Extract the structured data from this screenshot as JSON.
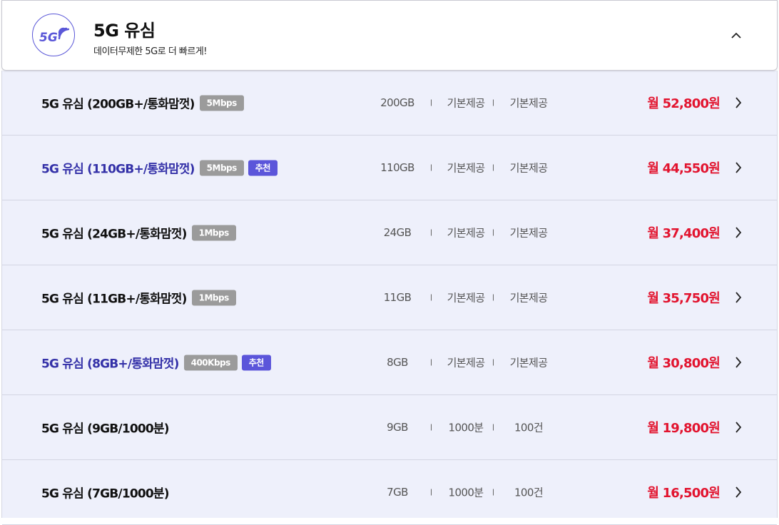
{
  "header": {
    "title": "5G 유심",
    "subtitle": "데이터무제한 5G로 더 빠르게!",
    "logo_text": "5G",
    "logo_icon": "5g-signal-icon",
    "collapse_icon": "chevron-up-icon"
  },
  "colors": {
    "accent": "#5a57d8",
    "price": "#e2142f",
    "recommended_name": "#3431a8",
    "list_bg": "#eef0fb",
    "speed_badge": "#9b9b9b"
  },
  "plans": [
    {
      "name": "5G 유심 (200GB+/통화맘껏)",
      "speed": "5Mbps",
      "recommend": "",
      "data": "200GB",
      "voice": "기본제공",
      "sms": "기본제공",
      "price": "월 52,800원"
    },
    {
      "name": "5G 유심 (110GB+/통화맘껏)",
      "speed": "5Mbps",
      "recommend": "추천",
      "data": "110GB",
      "voice": "기본제공",
      "sms": "기본제공",
      "price": "월 44,550원"
    },
    {
      "name": "5G 유심 (24GB+/통화맘껏)",
      "speed": "1Mbps",
      "recommend": "",
      "data": "24GB",
      "voice": "기본제공",
      "sms": "기본제공",
      "price": "월 37,400원"
    },
    {
      "name": "5G 유심 (11GB+/통화맘껏)",
      "speed": "1Mbps",
      "recommend": "",
      "data": "11GB",
      "voice": "기본제공",
      "sms": "기본제공",
      "price": "월 35,750원"
    },
    {
      "name": "5G 유심 (8GB+/통화맘껏)",
      "speed": "400Kbps",
      "recommend": "추천",
      "data": "8GB",
      "voice": "기본제공",
      "sms": "기본제공",
      "price": "월 30,800원"
    },
    {
      "name": "5G 유심 (9GB/1000분)",
      "speed": "",
      "recommend": "",
      "data": "9GB",
      "voice": "1000분",
      "sms": "100건",
      "price": "월 19,800원"
    },
    {
      "name": "5G 유심 (7GB/1000분)",
      "speed": "",
      "recommend": "",
      "data": "7GB",
      "voice": "1000분",
      "sms": "100건",
      "price": "월 16,500원"
    }
  ]
}
